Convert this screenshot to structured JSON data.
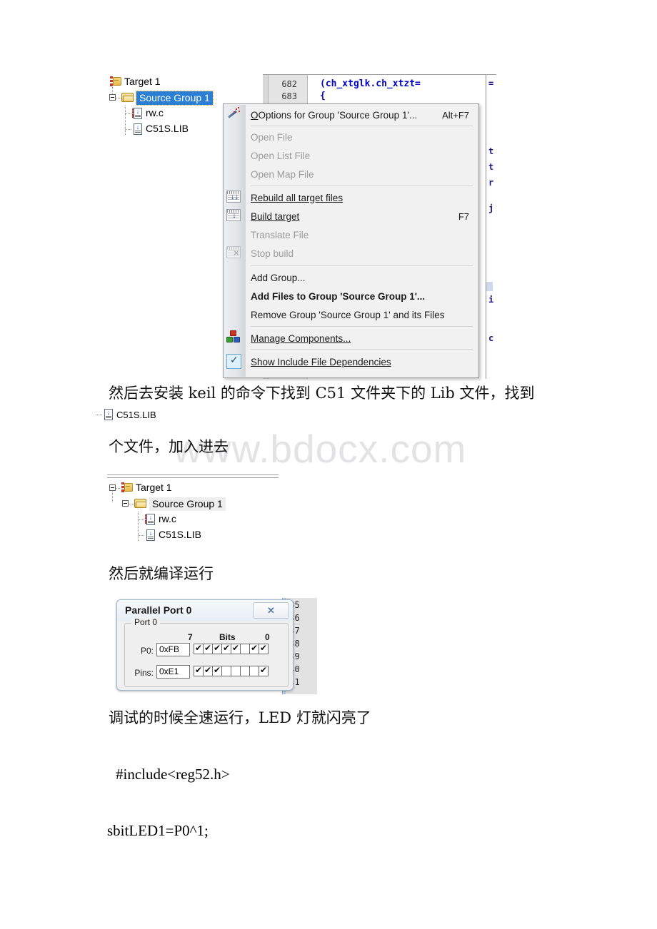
{
  "watermark": "www.bdocx.com",
  "shot1": {
    "editor": {
      "lines": [
        {
          "num": "682",
          "code": "(ch_xtglk.ch_xtzt="
        },
        {
          "num": "683",
          "code": "{"
        }
      ],
      "right_fragments": [
        "=",
        "t",
        "t",
        "r",
        "j",
        "i",
        "c"
      ]
    },
    "tree": {
      "nodes": [
        {
          "label": "Target 1",
          "icon": "target-icon",
          "state": "normal"
        },
        {
          "label": "Source Group 1",
          "icon": "folder-icon",
          "state": "selected"
        },
        {
          "label": "rw.c",
          "icon": "c-source-file-icon",
          "state": "normal"
        },
        {
          "label": "C51S.LIB",
          "icon": "library-file-icon",
          "state": "normal"
        }
      ]
    },
    "menu": {
      "items": [
        {
          "label": "Options for Group 'Source Group 1'...",
          "shortcut": "Alt+F7",
          "icon": "wand-icon",
          "disabled": false,
          "bold": false,
          "accel": "p"
        },
        {
          "label": "Open File",
          "shortcut": "",
          "icon": "",
          "disabled": true,
          "bold": false,
          "accel": "O"
        },
        {
          "label": "Open List File",
          "shortcut": "",
          "icon": "",
          "disabled": true,
          "bold": false,
          "accel": "L"
        },
        {
          "label": "Open Map File",
          "shortcut": "",
          "icon": "",
          "disabled": true,
          "bold": false,
          "accel": "M"
        },
        {
          "label": "Rebuild all target files",
          "shortcut": "",
          "icon": "rebuild-icon",
          "disabled": false,
          "bold": false,
          "accel": "R"
        },
        {
          "label": "Build target",
          "shortcut": "F7",
          "icon": "build-icon",
          "disabled": false,
          "bold": false,
          "accel": "B"
        },
        {
          "label": "Translate File",
          "shortcut": "",
          "icon": "",
          "disabled": true,
          "bold": false,
          "accel": "a"
        },
        {
          "label": "Stop build",
          "shortcut": "",
          "icon": "stop-build-icon",
          "disabled": true,
          "bold": false,
          "accel": "u"
        },
        {
          "label": "Add Group...",
          "shortcut": "",
          "icon": "",
          "disabled": false,
          "bold": false,
          "accel": "d"
        },
        {
          "label": "Add Files to Group 'Source Group 1'...",
          "shortcut": "",
          "icon": "",
          "disabled": false,
          "bold": true,
          "accel": ""
        },
        {
          "label": "Remove Group 'Source Group 1' and its Files",
          "shortcut": "",
          "icon": "",
          "disabled": false,
          "bold": false,
          "accel": "v"
        },
        {
          "label": "Manage Components...",
          "shortcut": "",
          "icon": "components-icon",
          "disabled": false,
          "bold": false,
          "accel": "C"
        },
        {
          "label": "Show Include File Dependencies",
          "shortcut": "",
          "icon": "checked-box-icon",
          "disabled": false,
          "bold": false,
          "accel": "n"
        }
      ]
    }
  },
  "text": {
    "line1": "然后去安装 keil 的命令下找到 C51 文件夹下的 Lib 文件，找到",
    "libfile": "C51S.LIB",
    "line2": "个文件，加入进去",
    "line3": "然后就编译运行",
    "line4": "调试的时候全速运行，LED 灯就闪亮了",
    "code1": "#include<reg52.h>",
    "code2": "sbitLED1=P0^1;"
  },
  "shot2": {
    "tree": {
      "nodes": [
        {
          "label": "Target 1",
          "icon": "target-icon",
          "state": "normal"
        },
        {
          "label": "Source Group 1",
          "icon": "folder-icon",
          "state": "soft-selected"
        },
        {
          "label": "rw.c",
          "icon": "c-source-file-icon",
          "state": "normal"
        },
        {
          "label": "C51S.LIB",
          "icon": "library-file-icon",
          "state": "normal"
        }
      ]
    }
  },
  "shot3": {
    "dialog": {
      "title": "Parallel Port 0",
      "close_label": "✕",
      "group_legend": "Port 0",
      "rows": [
        {
          "label": "P0:",
          "value": "0xFB",
          "bits": [
            1,
            1,
            1,
            1,
            1,
            0,
            1,
            1
          ]
        },
        {
          "label": "Pins:",
          "value": "0xE1",
          "bits": [
            1,
            1,
            1,
            0,
            0,
            0,
            0,
            1
          ]
        }
      ],
      "bits_header": {
        "high": "7",
        "mid": "Bits",
        "low": "0"
      }
    },
    "editor_lines": [
      "835",
      "836",
      "837",
      "838",
      "839",
      "840",
      "841"
    ]
  }
}
